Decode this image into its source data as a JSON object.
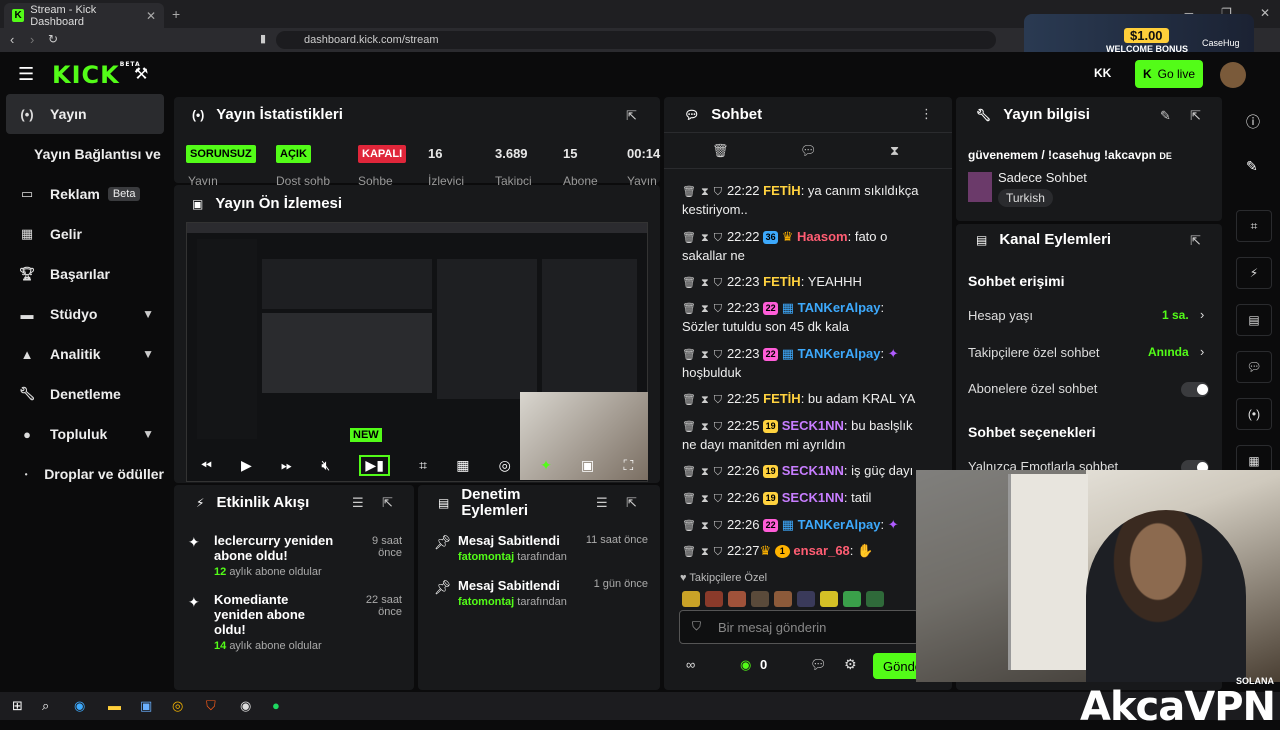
{
  "browser": {
    "tab_title": "Stream - Kick Dashboard",
    "url": "dashboard.kick.com/stream",
    "promo": {
      "amount": "$1.00",
      "label": "WELCOME BONUS",
      "brand": "CaseHug"
    }
  },
  "topbar": {
    "logo": "KICK",
    "logo_sup": "BETA",
    "go_live": "Go live"
  },
  "sidebar": {
    "items": [
      {
        "label": "Yayın",
        "icon": "broadcast-icon",
        "active": true
      },
      {
        "label": "Yayın Bağlantısı ve Anahtarı"
      },
      {
        "label": "Reklam",
        "badge": "Beta"
      },
      {
        "label": "Gelir"
      },
      {
        "label": "Başarılar"
      },
      {
        "label": "Stüdyo"
      },
      {
        "label": "Analitik"
      },
      {
        "label": "Denetleme"
      },
      {
        "label": "Topluluk"
      },
      {
        "label": "Droplar ve ödüller"
      }
    ]
  },
  "stats": {
    "title": "Yayın İstatistikleri",
    "pills": [
      "SORUNSUZ",
      "AÇIK",
      "KAPALI"
    ],
    "values": [
      "16",
      "3.689",
      "15",
      "00:14"
    ],
    "labels": [
      "Yayın",
      "Dost sohb",
      "Sohbe",
      "İzleyici",
      "Takipçi",
      "Abone",
      "Yayın"
    ]
  },
  "preview": {
    "title": "Yayın Ön İzlemesi",
    "new_badge": "NEW"
  },
  "activity": {
    "title": "Etkinlik Akışı",
    "items": [
      {
        "name": "leclercurry yeniden abone oldu!",
        "sub_count": "12",
        "sub_text": "aylık abone oldular",
        "time": "9 saat önce"
      },
      {
        "name": "Komediante yeniden abone oldu!",
        "sub_count": "14",
        "sub_text": "aylık abone oldular",
        "time": "22 saat önce"
      }
    ]
  },
  "moderation": {
    "title": "Denetim Eylemleri",
    "items": [
      {
        "title": "Mesaj Sabitlendi",
        "user": "fatomontaj",
        "by": "tarafından",
        "time": "11 saat önce"
      },
      {
        "title": "Mesaj Sabitlendi",
        "user": "fatomontaj",
        "by": "tarafından",
        "time": "1 gün önce"
      }
    ]
  },
  "chat": {
    "title": "Sohbet",
    "followers_label": "Takipçilere Özel",
    "input_placeholder": "Bir mesaj gönderin",
    "points": "0",
    "send": "Gönder",
    "messages": [
      {
        "time": "22:22",
        "user": "FETİH",
        "color": "#ffd23f",
        "text": "ya canım sıkıldıkça kestiriyom.."
      },
      {
        "time": "22:22",
        "badge": "36",
        "user": "Haasom",
        "color": "#ff5d73",
        "text": "fato o sakallar ne"
      },
      {
        "time": "22:23",
        "user": "FETİH",
        "color": "#ffd23f",
        "text": "YEAHHH"
      },
      {
        "time": "22:23",
        "badge": "22",
        "user": "TANKerAlpay",
        "color": "#3da9fc",
        "text": "Sözler tutuldu son 45 dk kala"
      },
      {
        "time": "22:23",
        "badge": "22",
        "user": "TANKerAlpay",
        "color": "#3da9fc",
        "text": "hoşbulduk"
      },
      {
        "time": "22:25",
        "user": "FETİH",
        "color": "#ffd23f",
        "text": "bu adam KRAL YA"
      },
      {
        "time": "22:25",
        "badge": "19",
        "user": "SECK1NN",
        "color": "#c77dff",
        "text": "bu baslşlık ne dayı manitden mi ayrıldın"
      },
      {
        "time": "22:26",
        "badge": "19",
        "user": "SECK1NN",
        "color": "#c77dff",
        "text": "iş güç dayı"
      },
      {
        "time": "22:26",
        "badge": "19",
        "user": "SECK1NN",
        "color": "#c77dff",
        "text": "tatil"
      },
      {
        "time": "22:26",
        "badge": "22",
        "user": "TANKerAlpay",
        "color": "#3da9fc",
        "text": ""
      },
      {
        "time": "22:27",
        "badge": "1",
        "user": "ensar_68",
        "color": "#ff5d73",
        "text": ""
      }
    ]
  },
  "info": {
    "title": "Yayın bilgisi",
    "stream_title": "güvenemem / !casehug !akcavpn",
    "lang_code": "DE",
    "category": "Sadece Sohbet",
    "tag": "Turkish"
  },
  "channel_actions": {
    "title": "Kanal Eylemleri",
    "chat_access": "Sohbet erişimi",
    "account_age": "Hesap yaşı",
    "account_age_val": "1 sa.",
    "followers_only": "Takipçilere özel sohbet",
    "followers_only_val": "Anında",
    "subs_only": "Abonelere özel sohbet",
    "chat_options": "Sohbet seçenekleri",
    "emote_only": "Yalnızca Emotlarla sohbet"
  },
  "overlay": {
    "brand": "AkcaVPN",
    "sponsor": "SOLANA"
  }
}
